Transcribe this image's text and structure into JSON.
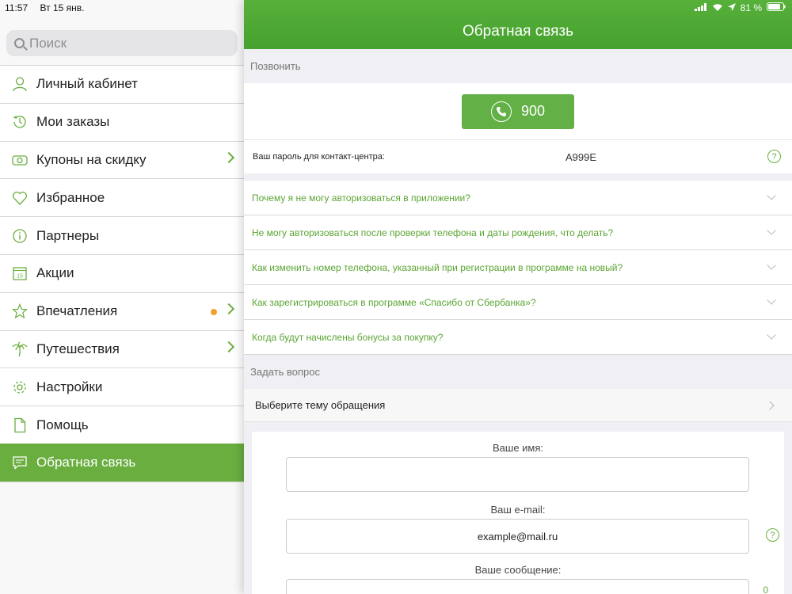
{
  "status": {
    "time": "11:57",
    "date": "Вт 15 янв.",
    "battery": "81 %"
  },
  "sidebar": {
    "search_placeholder": "Поиск",
    "items": [
      {
        "label": "Личный кабинет",
        "icon": "user-icon"
      },
      {
        "label": "Мои заказы",
        "icon": "history-icon"
      },
      {
        "label": "Купоны на скидку",
        "icon": "coupon-icon",
        "chevron": true
      },
      {
        "label": "Избранное",
        "icon": "heart-icon"
      },
      {
        "label": "Партнеры",
        "icon": "info-icon"
      },
      {
        "label": "Акции",
        "icon": "calendar-icon",
        "badge_text": "15"
      },
      {
        "label": "Впечатления",
        "icon": "star-icon",
        "chevron": true,
        "dot": true
      },
      {
        "label": "Путешествия",
        "icon": "palm-icon",
        "chevron": true
      },
      {
        "label": "Настройки",
        "icon": "gear-icon"
      },
      {
        "label": "Помощь",
        "icon": "document-icon"
      },
      {
        "label": "Обратная связь",
        "icon": "chat-icon",
        "active": true
      }
    ]
  },
  "main": {
    "title": "Обратная связь",
    "call_section_label": "Позвонить",
    "call_number": "900",
    "password_label": "Ваш пароль для контакт-центра:",
    "password_value": "A999E",
    "help_glyph": "?",
    "faq": [
      "Почему я не могу авторизоваться в приложении?",
      "Не могу авторизоваться после проверки телефона и даты рождения, что делать?",
      "Как изменить номер телефона, указанный при регистрации в программе на новый?",
      "Как зарегистрироваться в программе «Спасибо от Сбербанка»?",
      "Когда будут начислены бонусы за покупку?"
    ],
    "ask_section_label": "Задать вопрос",
    "topic_label": "Выберите тему обращения",
    "form": {
      "name_label": "Ваше имя:",
      "name_value": "",
      "email_label": "Ваш e-mail:",
      "email_value": "example@mail.ru",
      "message_label": "Ваше сообщение:",
      "message_counter": "0"
    }
  },
  "colors": {
    "accent": "#6aae40",
    "header": "#4caa34",
    "dot": "#f0a030"
  }
}
